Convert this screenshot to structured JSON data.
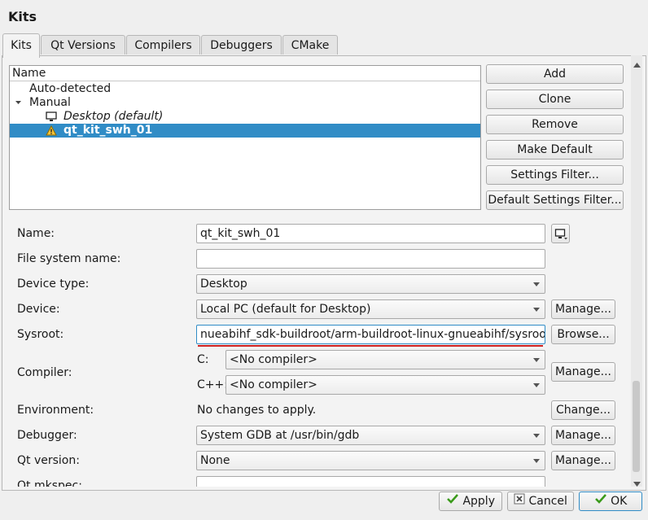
{
  "window": {
    "title": "Kits"
  },
  "tabs": [
    "Kits",
    "Qt Versions",
    "Compilers",
    "Debuggers",
    "CMake"
  ],
  "tree": {
    "header": "Name",
    "auto_detected": "Auto-detected",
    "manual": "Manual",
    "desktop_kit": "Desktop (default)",
    "selected_kit": "qt_kit_swh_01"
  },
  "side_buttons": {
    "add": "Add",
    "clone": "Clone",
    "remove": "Remove",
    "make_default": "Make Default",
    "settings_filter": "Settings Filter...",
    "default_settings_filter": "Default Settings Filter..."
  },
  "form": {
    "name_label": "Name:",
    "name_value": "qt_kit_swh_01",
    "fs_label": "File system name:",
    "fs_value": "",
    "device_type_label": "Device type:",
    "device_type_value": "Desktop",
    "device_label": "Device:",
    "device_value": "Local PC (default for Desktop)",
    "device_manage": "Manage...",
    "sysroot_label": "Sysroot:",
    "sysroot_value": "nueabihf_sdk-buildroot/arm-buildroot-linux-gnueabihf/sysroot",
    "sysroot_browse": "Browse...",
    "compiler_label": "Compiler:",
    "c_label": "C:",
    "c_value": "<No compiler>",
    "cpp_label": "C++:",
    "cpp_value": "<No compiler>",
    "compiler_manage": "Manage...",
    "env_label": "Environment:",
    "env_value": "No changes to apply.",
    "env_change": "Change...",
    "debugger_label": "Debugger:",
    "debugger_value": "System GDB at /usr/bin/gdb",
    "debugger_manage": "Manage...",
    "qt_version_label": "Qt version:",
    "qt_version_value": "None",
    "qt_version_manage": "Manage...",
    "qt_mkspec_label": "Qt mkspec:"
  },
  "dialog_buttons": {
    "apply": "Apply",
    "cancel": "Cancel",
    "ok": "OK"
  },
  "colors": {
    "selection": "#308cc6",
    "focus": "#308cc6",
    "underline": "#cc2222",
    "check": "#3a9a1a",
    "cancel_x": "#444444"
  }
}
